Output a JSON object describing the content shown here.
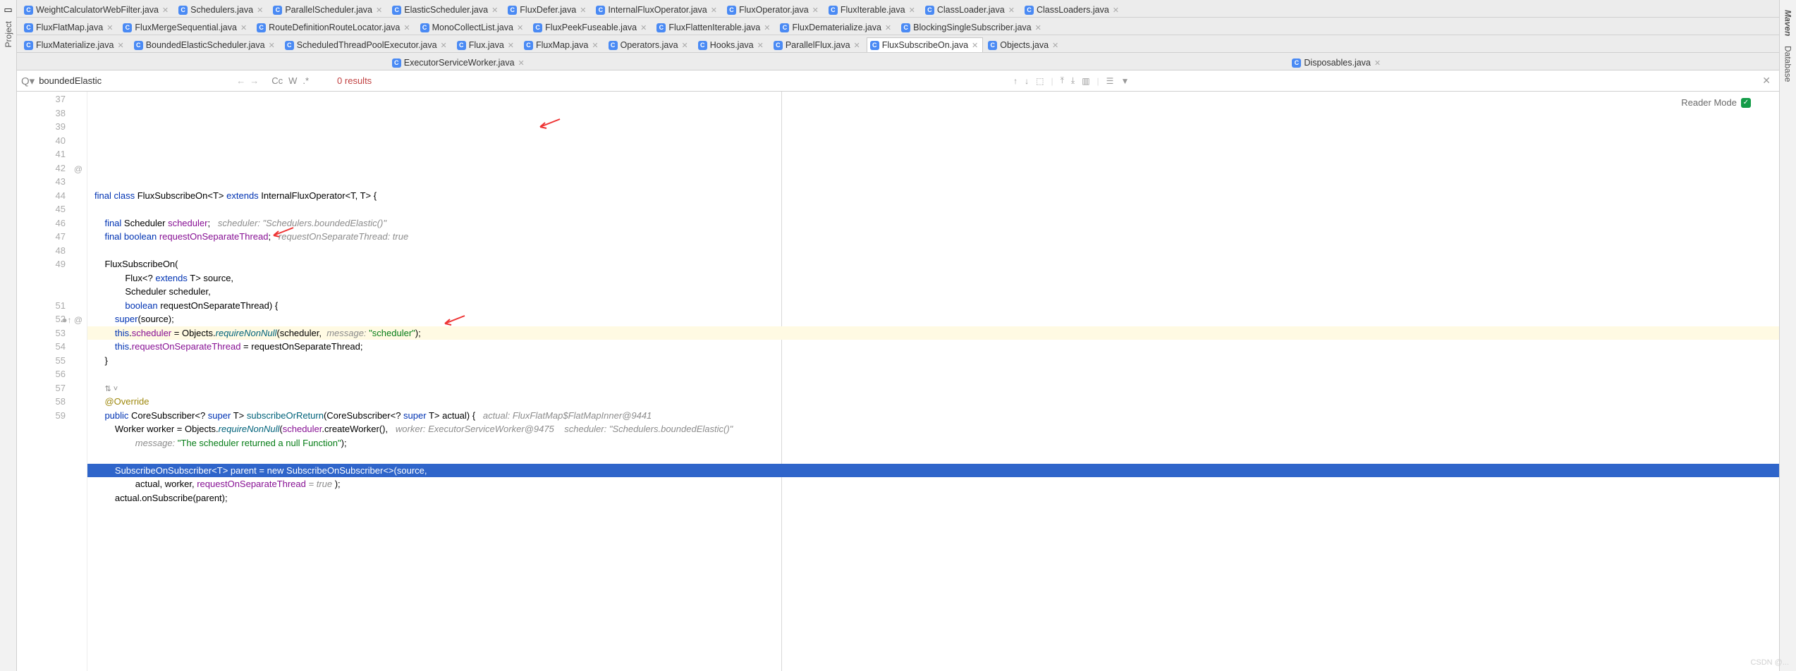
{
  "leftRail": {
    "label": "Project"
  },
  "rightRail": {
    "labels": [
      "Maven",
      "Database"
    ]
  },
  "watermark": "CSDN @...",
  "tabsRow1": [
    "WeightCalculatorWebFilter.java",
    "Schedulers.java",
    "ParallelScheduler.java",
    "ElasticScheduler.java",
    "FluxDefer.java",
    "InternalFluxOperator.java",
    "FluxOperator.java",
    "FluxIterable.java",
    "ClassLoader.java",
    "ClassLoaders.java"
  ],
  "tabsRow2": [
    "FluxFlatMap.java",
    "FluxMergeSequential.java",
    "RouteDefinitionRouteLocator.java",
    "MonoCollectList.java",
    "FluxPeekFuseable.java",
    "FluxFlattenIterable.java",
    "FluxDematerialize.java",
    "BlockingSingleSubscriber.java"
  ],
  "tabsRow3": [
    "FluxMaterialize.java",
    "BoundedElasticScheduler.java",
    "ScheduledThreadPoolExecutor.java",
    "Flux.java",
    "FluxMap.java",
    "Operators.java",
    "Hooks.java",
    "ParallelFlux.java",
    "FluxSubscribeOn.java",
    "Objects.java"
  ],
  "tabsRow4": [
    "ExecutorServiceWorker.java",
    "Disposables.java"
  ],
  "activeTab": "FluxSubscribeOn.java",
  "find": {
    "query": "boundedElastic",
    "results": "0 results",
    "labels": {
      "cc": "Cc",
      "w": "W",
      "star": ".*"
    }
  },
  "reader": {
    "label": "Reader Mode"
  },
  "code": {
    "startLine": 37,
    "lines": [
      {
        "n": 37,
        "html": "<span class='kw'>final class</span> FluxSubscribeOn&lt;T&gt; <span class='kw'>extends</span> InternalFluxOperator&lt;T, T&gt; {"
      },
      {
        "n": 38,
        "html": ""
      },
      {
        "n": 39,
        "html": "    <span class='kw'>final</span> Scheduler <span class='fld'>scheduler</span>;   <span class='cmt'>scheduler: \"Schedulers.boundedElastic()\"</span>"
      },
      {
        "n": 40,
        "html": "    <span class='kw'>final boolean</span> <span class='fld'>requestOnSeparateThread</span>;   <span class='cmt'>requestOnSeparateThread: true</span>"
      },
      {
        "n": 41,
        "html": ""
      },
      {
        "n": 42,
        "mark": "@",
        "html": "    FluxSubscribeOn("
      },
      {
        "n": 43,
        "html": "            Flux&lt;? <span class='kw'>extends</span> T&gt; source,"
      },
      {
        "n": 44,
        "html": "            Scheduler scheduler,"
      },
      {
        "n": 45,
        "html": "            <span class='kw'>boolean</span> requestOnSeparateThread) {"
      },
      {
        "n": 46,
        "html": "        <span class='kw'>super</span>(source);"
      },
      {
        "n": 47,
        "hl": true,
        "bulb": true,
        "html": "        <span class='kw'>this</span>.<span class='fld'>scheduler</span> = Objects.<span class='ital'>requireNonNull</span>(scheduler,  <span class='cmt'>message:</span> <span class='str'>\"scheduler\"</span>);"
      },
      {
        "n": 48,
        "html": "        <span class='kw'>this</span>.<span class='fld'>requestOnSeparateThread</span> = requestOnSeparateThread;"
      },
      {
        "n": 49,
        "html": "    }"
      },
      {
        "n": "",
        "html": ""
      },
      {
        "n": "",
        "html": "    <span class='dots'>⇅ ˅</span>"
      },
      {
        "n": 51,
        "html": "    <span class='ann'>@Override</span>"
      },
      {
        "n": 52,
        "mark": "●↑ @",
        "html": "    <span class='kw'>public</span> CoreSubscriber&lt;? <span class='kw'>super</span> T&gt; <span class='mth'>subscribeOrReturn</span>(CoreSubscriber&lt;? <span class='kw'>super</span> T&gt; actual) {   <span class='cmt'>actual: FluxFlatMap$FlatMapInner@9441</span>"
      },
      {
        "n": 53,
        "html": "        Worker worker = Objects.<span class='ital'>requireNonNull</span>(<span class='fld'>scheduler</span>.createWorker(),   <span class='cmt'>worker: ExecutorServiceWorker@9475    scheduler: \"Schedulers.boundedElastic()\"</span>"
      },
      {
        "n": 54,
        "html": "                <span class='cmt'>message:</span> <span class='str'>\"The scheduler returned a null Function\"</span>);"
      },
      {
        "n": 55,
        "html": ""
      },
      {
        "n": 56,
        "sel": true,
        "html": "        SubscribeOnSubscriber&lt;T&gt; parent = new SubscribeOnSubscriber&lt;&gt;(source,"
      },
      {
        "n": 57,
        "html": "                actual, worker, <span class='fld'>requestOnSeparateThread</span> <span class='cmt'>= true</span> );"
      },
      {
        "n": 58,
        "html": "        actual.onSubscribe(parent);"
      },
      {
        "n": 59,
        "html": ""
      }
    ]
  }
}
